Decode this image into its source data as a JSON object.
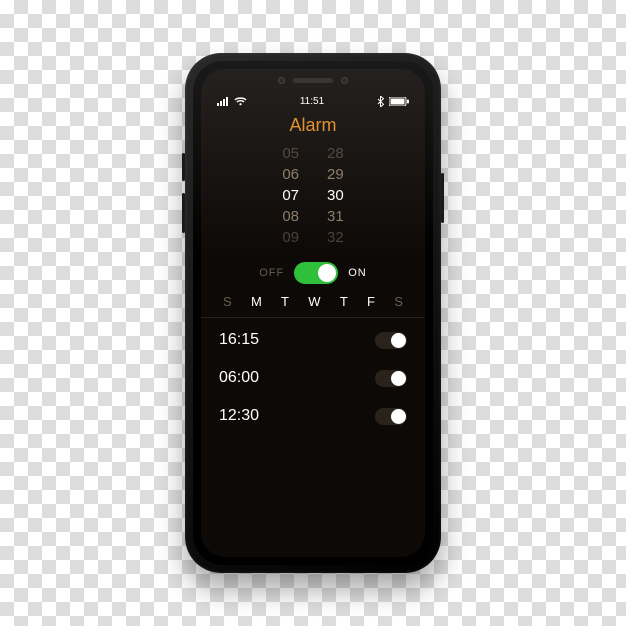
{
  "status": {
    "time": "11:51"
  },
  "title": "Alarm",
  "picker": {
    "hours": [
      "05",
      "06",
      "07",
      "08",
      "09"
    ],
    "minutes": [
      "28",
      "29",
      "30",
      "31",
      "32"
    ],
    "selected_index": 2
  },
  "toggle": {
    "off_label": "OFF",
    "on_label": "ON",
    "state": "on"
  },
  "days": {
    "labels": [
      "S",
      "M",
      "T",
      "W",
      "T",
      "F",
      "S"
    ],
    "active": [
      false,
      true,
      true,
      true,
      true,
      true,
      false
    ]
  },
  "alarms": [
    {
      "time": "16:15",
      "enabled": true
    },
    {
      "time": "06:00",
      "enabled": true
    },
    {
      "time": "12:30",
      "enabled": true
    }
  ]
}
